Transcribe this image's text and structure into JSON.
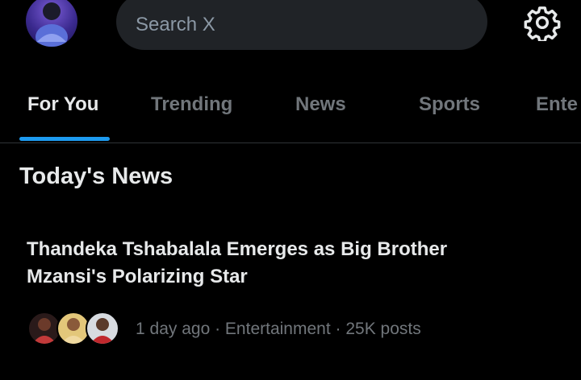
{
  "colors": {
    "background": "#000000",
    "search_bg": "#202327",
    "accent": "#1d9bf0",
    "text_primary": "#e7e9ea",
    "text_secondary": "#71767b"
  },
  "header": {
    "avatar_icon": "profile-avatar",
    "search": {
      "placeholder": "Search X"
    },
    "settings_icon": "gear-icon"
  },
  "tabs": [
    {
      "label": "For You",
      "active": true
    },
    {
      "label": "Trending",
      "active": false
    },
    {
      "label": "News",
      "active": false
    },
    {
      "label": "Sports",
      "active": false
    },
    {
      "label": "Ente",
      "active": false
    }
  ],
  "section": {
    "title": "Today's News"
  },
  "news_item": {
    "headline": "Thandeka Tshabalala Emerges as Big Brother Mzansi's Polarizing Star",
    "time": "1 day ago",
    "category": "Entertainment",
    "posts": "25K posts",
    "separator": " · "
  }
}
